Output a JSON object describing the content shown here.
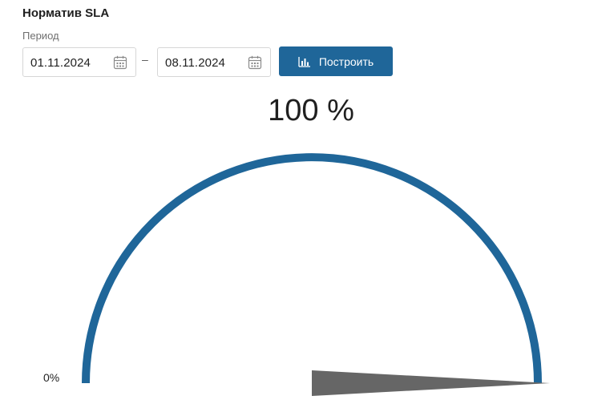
{
  "widget": {
    "title": "Норматив SLA",
    "period_label": "Период",
    "date_from": "01.11.2024",
    "date_separator": "–",
    "date_to": "08.11.2024",
    "build_button_label": "Построить",
    "build_button_icon": "bar-chart-icon",
    "calendar_icon": "calendar-icon",
    "accent_color": "#1f6699",
    "needle_color": "#666666"
  },
  "chart_data": {
    "type": "gauge",
    "value": 100,
    "value_label": "100 %",
    "min": 0,
    "max": 100,
    "min_label": "0%"
  }
}
